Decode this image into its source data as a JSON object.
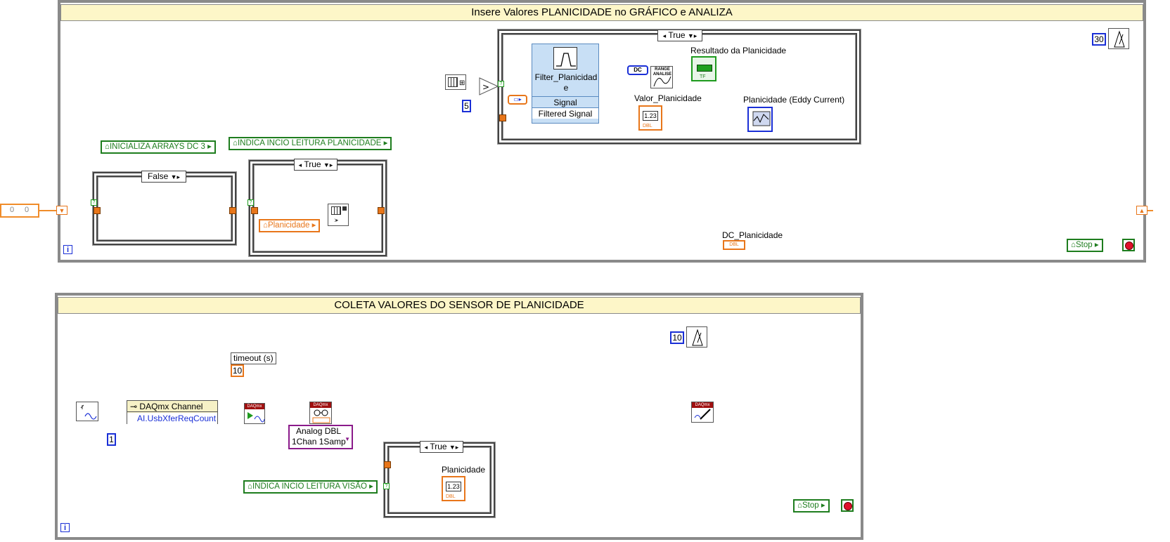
{
  "loop1": {
    "title": "Insere Valores PLANICIDADE no GRÁFICO e ANALIZA",
    "wait_ms": "30",
    "iteration_icon": "i",
    "stop_label": "Stop",
    "input_values": [
      "0",
      "0"
    ],
    "case_false_selector": "False",
    "case_true_selector": "True",
    "case_top_selector": "True",
    "local_var_inicializa": "INICIALIZA ARRAYS DC 3",
    "local_var_indica": "INDICA INCIO LEITURA PLANICIDADE",
    "local_var_planicidade": "Planicidade",
    "const_5": "5",
    "filter_title": "Filter_Planicidade",
    "filter_signal": "Signal",
    "filter_filtered": "Filtered Signal",
    "range_label": "RANGE ANALISE",
    "dc_label": "DC",
    "resultado_label": "Resultado da Planicidade",
    "valor_label": "Valor_Planicidade",
    "planicidade_eddy_label": "Planicidade (Eddy Current)",
    "dc_planicidade_label": "DC_Planicidade",
    "num_indicator_value": "1.23",
    "dbl_tag": "DBL",
    "tf_tag": "TF"
  },
  "loop2": {
    "title": "COLETA VALORES DO SENSOR DE PLANICIDADE",
    "wait_ms": "10",
    "iteration_icon": "i",
    "stop_label": "Stop",
    "daqmx_channel": "DAQmx Channel",
    "daqmx_property": "AI.UsbXferReqCount",
    "const_1": "1",
    "timeout_label": "timeout (s)",
    "timeout_value": "10",
    "read_mode_line1": "Analog DBL",
    "read_mode_line2": "1Chan 1Samp",
    "case_selector": "True",
    "planicidade_label": "Planicidade",
    "local_var_visao": "INDICA INCIO LEITURA VISÃO",
    "num_indicator_value": "1.23",
    "dbl_tag": "DBL",
    "daqmx_tag": "DAQmx"
  },
  "colors": {
    "orange_wire": "#f08c2a",
    "blue_wire": "#1a2fd6",
    "green_wire": "#1e9a1e",
    "loop_title_bg": "#fdf6c8",
    "purple_wire": "#8a1a8a"
  }
}
